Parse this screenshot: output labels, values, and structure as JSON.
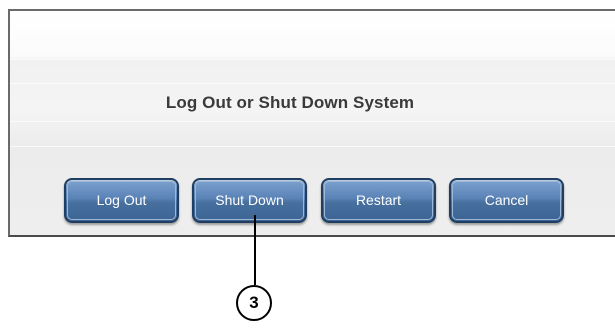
{
  "dialog": {
    "title": "Log Out or Shut Down System",
    "buttons": [
      {
        "label": "Log Out"
      },
      {
        "label": "Shut Down"
      },
      {
        "label": "Restart"
      },
      {
        "label": "Cancel"
      }
    ]
  },
  "callout": {
    "number": "3"
  },
  "colors": {
    "button_fill": "#5a82b6",
    "button_border": "#1f3e62",
    "dialog_background": "#f1f1f1",
    "title_text": "#3a3a3a"
  }
}
